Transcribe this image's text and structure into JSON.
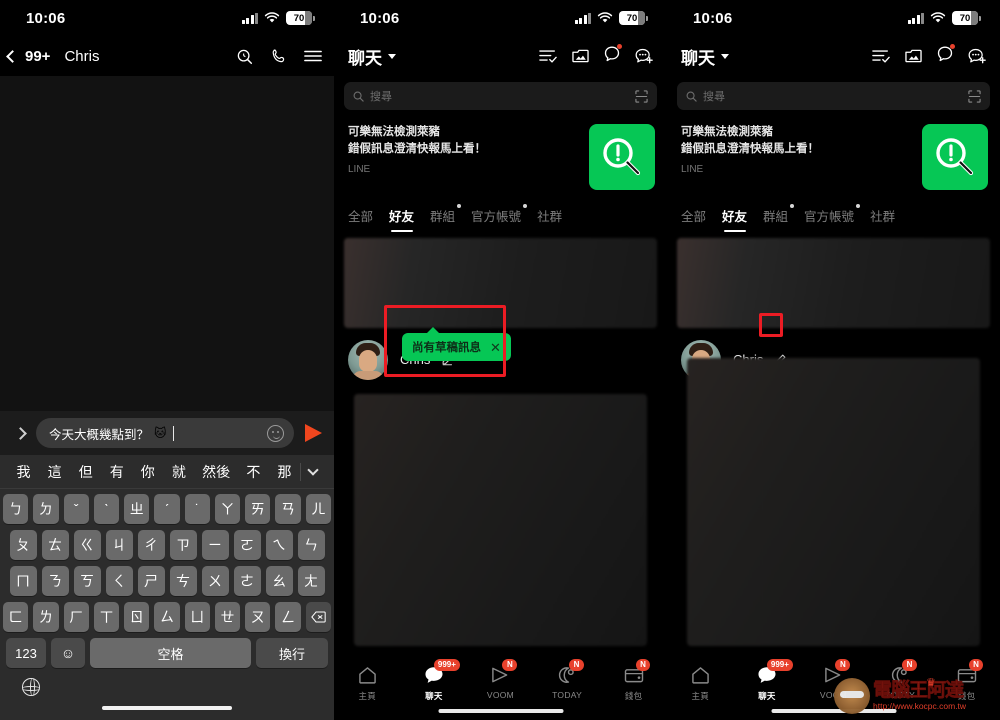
{
  "status_bar": {
    "time": "10:06",
    "battery": "70",
    "signal_icon": "cellular-bars-icon",
    "wifi_icon": "wifi-icon"
  },
  "panel_chat": {
    "nav": {
      "back_icon": "chevron-left-icon",
      "unread_count": "99+",
      "title": "Chris",
      "icons": [
        "search-icon",
        "phone-icon",
        "menu-icon"
      ]
    },
    "composer": {
      "expand_icon": "chevron-right-icon",
      "text": "今天大概幾點到？",
      "emoji": "🐱",
      "emoji_icon": "smiley-icon",
      "send_icon": "send-arrow-icon"
    },
    "keyboard": {
      "candidates": [
        "我",
        "這",
        "但",
        "有",
        "你",
        "就",
        "然後",
        "不",
        "那"
      ],
      "collapse_icon": "chevron-down-icon",
      "row1": [
        "ㄅ",
        "ㄉ",
        "ˇ",
        "ˋ",
        "ㄓ",
        "ˊ",
        "˙",
        "ㄚ",
        "ㄞ",
        "ㄢ",
        "ㄦ"
      ],
      "row2": [
        "ㄆ",
        "ㄊ",
        "ㄍ",
        "ㄐ",
        "ㄔ",
        "ㄗ",
        "ㄧ",
        "ㄛ",
        "ㄟ",
        "ㄣ"
      ],
      "row3": [
        "ㄇ",
        "ㄋ",
        "ㄎ",
        "ㄑ",
        "ㄕ",
        "ㄘ",
        "ㄨ",
        "ㄜ",
        "ㄠ",
        "ㄤ"
      ],
      "row4": [
        "ㄈ",
        "ㄌ",
        "ㄏ",
        "ㄒ",
        "ㄖ",
        "ㄙ",
        "ㄩ",
        "ㄝ",
        "ㄡ",
        "ㄥ"
      ],
      "delete_icon": "backspace-icon",
      "numeric_label": "123",
      "emoji_key_icon": "emoji-key-icon",
      "space_label": "空格",
      "enter_label": "換行",
      "globe_icon": "globe-icon"
    }
  },
  "panel_list": {
    "nav": {
      "title": "聊天",
      "dropdown_icon": "chevron-down-icon",
      "icons": [
        "checklist-icon",
        "photo-album-icon",
        "openchat-icon",
        "add-chat-icon"
      ]
    },
    "search": {
      "placeholder": "搜尋",
      "search_icon": "search-icon",
      "qr_icon": "qr-scan-icon"
    },
    "news": {
      "line1": "可樂無法檢測萊豬",
      "line2": "錯假訊息澄清快報馬上看！",
      "source": "LINE",
      "thumb_icon": "fact-check-magnifier-icon",
      "thumb_color": "#06c755"
    },
    "tabs": [
      {
        "label": "全部",
        "active": false,
        "dot": false
      },
      {
        "label": "好友",
        "active": true,
        "dot": false
      },
      {
        "label": "群組",
        "active": false,
        "dot": true
      },
      {
        "label": "官方帳號",
        "active": false,
        "dot": true
      },
      {
        "label": "社群",
        "active": false,
        "dot": false
      }
    ],
    "friend": {
      "name": "Chris",
      "pencil_icon": "pencil-draft-icon",
      "avatar_icon": "avatar"
    },
    "draft_tooltip": {
      "text": "尚有草稿訊息",
      "close_icon": "close-icon",
      "color": "#06c755"
    },
    "bottom_nav": [
      {
        "label": "主頁",
        "icon": "home-icon",
        "badge": "",
        "active": false
      },
      {
        "label": "聊天",
        "icon": "chat-icon",
        "badge": "999+",
        "active": true
      },
      {
        "label": "VOOM",
        "icon": "voom-icon",
        "badge": "N",
        "active": false
      },
      {
        "label": "TODAY",
        "icon": "today-icon",
        "badge": "N",
        "active": false
      },
      {
        "label": "錢包",
        "icon": "wallet-icon",
        "badge": "N",
        "active": false
      }
    ]
  },
  "annotations": {
    "highlight_color": "#ec1c24",
    "box_draft_tooltip": "draft-tooltip-highlight",
    "box_pencil_icon": "pencil-icon-highlight"
  },
  "watermark": {
    "title": "電腦王阿達",
    "url": "http://www.kocpc.com.tw",
    "crown_icon": "crown-icon"
  }
}
